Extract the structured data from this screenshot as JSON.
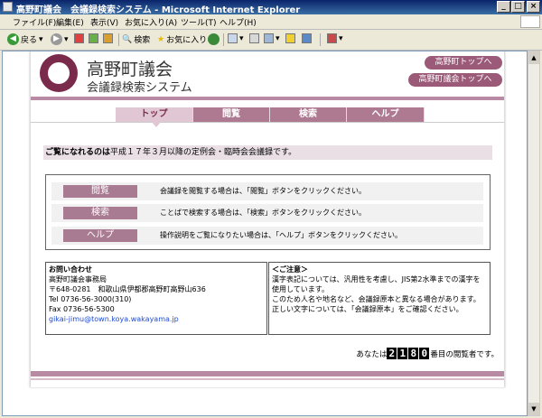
{
  "window": {
    "title": "高野町議会　会議録検索システム - Microsoft Internet Explorer",
    "controls": [
      "_",
      "□",
      "×"
    ]
  },
  "menu": [
    "ファイル(F)",
    "編集(E)",
    "表示(V)",
    "お気に入り(A)",
    "ツール(T)",
    "ヘルプ(H)"
  ],
  "toolbar": {
    "back_label": "戻る",
    "search_label": "検索",
    "favorites_label": "お気に入り"
  },
  "site": {
    "title": "高野町議会",
    "subtitle": "会議録検索システム",
    "top_links": [
      "高野町トップへ",
      "高野町議会トップへ"
    ],
    "nav_tabs": [
      "トップ",
      "閲覧",
      "検索",
      "ヘルプ"
    ],
    "active_tab": "トップ"
  },
  "intro": {
    "bold": "ご覧になれるのは",
    "text": "平成１７年３月以降の定例会・臨時会会議録です。"
  },
  "actions": [
    {
      "label": "閲覧",
      "desc": "会議録を閲覧する場合は、「閲覧」ボタンをクリックください。"
    },
    {
      "label": "検索",
      "desc": "ことばで検索する場合は、「検索」ボタンをクリックください。"
    },
    {
      "label": "ヘルプ",
      "desc": "操作説明をご覧になりたい場合は、「ヘルプ」ボタンをクリックください。"
    }
  ],
  "contact": {
    "heading": "お問い合わせ",
    "org": "高野町議会事務局",
    "address": "〒648-0281　和歌山県伊都郡高野町高野山636",
    "tel": "Tel 0736-56-3000(310)",
    "fax": "Fax 0736-56-5300",
    "email": "gikai-jimu@town.koya.wakayama.jp"
  },
  "notice": {
    "heading": "＜ご注意＞",
    "p1": "漢字表記については、汎用性を考慮し、JIS第2水準までの漢字を使用しています。",
    "p2": "このため人名や地名など、会議録原本と異なる場合があります。正しい文字については、「会議録原本」をご確認ください。"
  },
  "counter": {
    "prefix": "あなたは",
    "digits": [
      "2",
      "1",
      "8",
      "0"
    ],
    "suffix": "番目の閲覧者です。"
  }
}
